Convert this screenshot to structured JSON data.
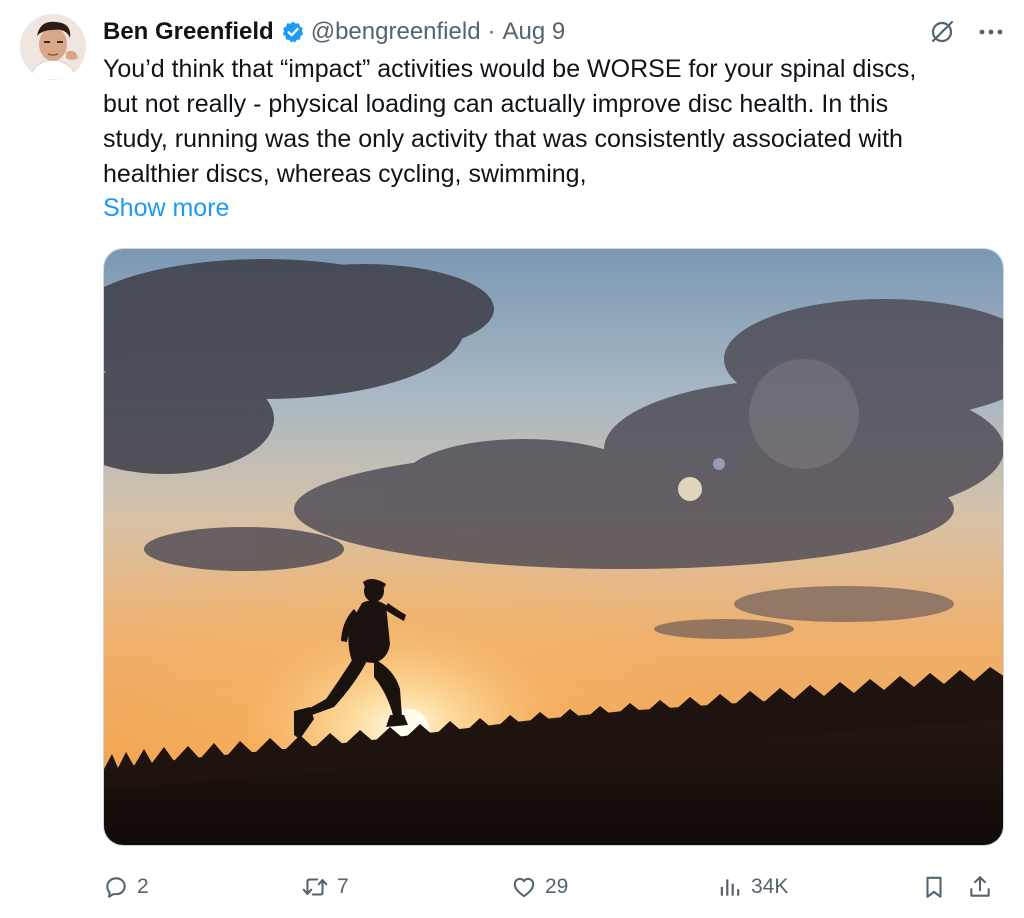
{
  "author": {
    "name": "Ben Greenfield",
    "handle": "@bengreenfield",
    "separator": "·",
    "date": "Aug 9",
    "verified_color": "#1d9bf0"
  },
  "tweet": {
    "lines": [
      "You’d think that “impact” activities would be WORSE for your spinal discs,",
      "but not really - physical loading can actually improve disc health. In this",
      "study, running was the only activity that was consistently associated with",
      "healthier discs, whereas cycling, swimming,"
    ],
    "show_more": "Show more"
  },
  "icons": {
    "avatar": "avatar-photo",
    "verified": "verified-badge-icon",
    "grok": "grok-icon",
    "more": "more-icon",
    "reply": "reply-icon",
    "retweet": "retweet-icon",
    "like": "heart-icon",
    "views": "views-icon",
    "bookmark": "bookmark-icon",
    "share": "share-icon"
  },
  "media": {
    "scene": "runner silhouette at sunset"
  },
  "stats": {
    "replies": "2",
    "retweets": "7",
    "likes": "29",
    "views": "34K"
  },
  "colors": {
    "accent": "#1d9bf0",
    "muted": "#536471",
    "text": "#0f1419"
  }
}
